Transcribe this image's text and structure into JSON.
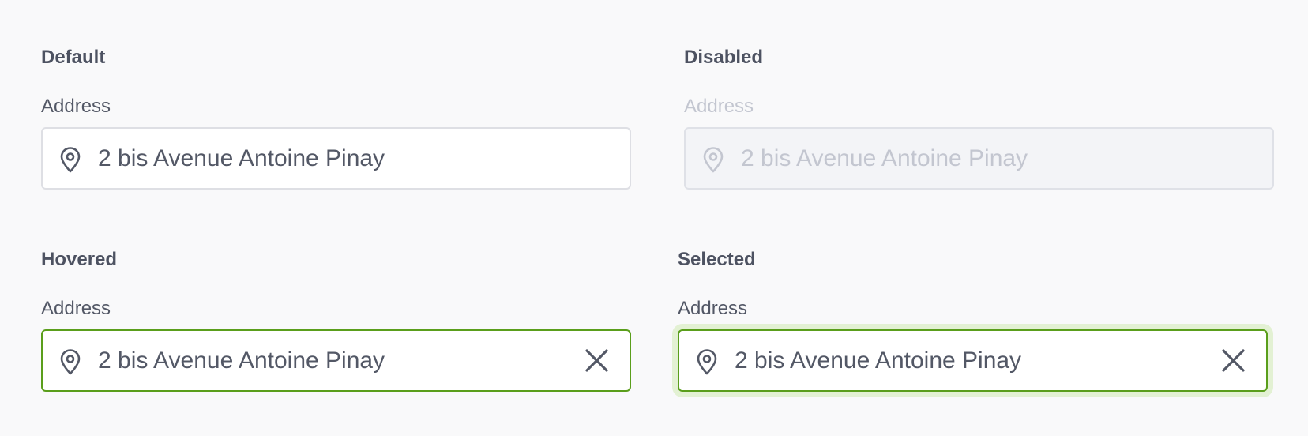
{
  "states": {
    "default": {
      "title": "Default",
      "label": "Address",
      "value": "2 bis Avenue Antoine Pinay"
    },
    "disabled": {
      "title": "Disabled",
      "label": "Address",
      "value": "2 bis Avenue Antoine Pinay"
    },
    "hovered": {
      "title": "Hovered",
      "label": "Address",
      "value": "2 bis Avenue Antoine Pinay"
    },
    "selected": {
      "title": "Selected",
      "label": "Address",
      "value": "2 bis Avenue Antoine Pinay"
    }
  },
  "icons": {
    "location": "location-pin-icon",
    "clear": "close-icon"
  },
  "colors": {
    "background": "#f9f9fa",
    "text": "#535866",
    "disabled_text": "#c3c6d0",
    "accent_border": "#5a9e1b",
    "focus_ring": "#e3f1d3"
  }
}
